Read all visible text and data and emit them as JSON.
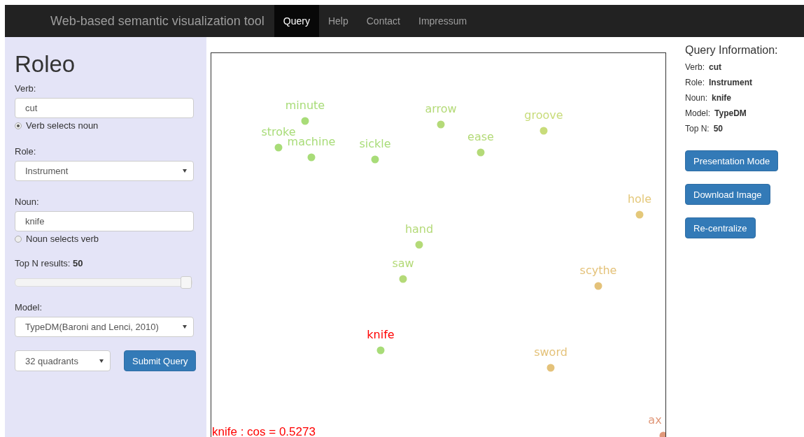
{
  "navbar": {
    "brand": "Web-based semantic visualization tool",
    "links": [
      {
        "label": "Query",
        "selected": true
      },
      {
        "label": "Help",
        "selected": false
      },
      {
        "label": "Contact",
        "selected": false
      },
      {
        "label": "Impressum",
        "selected": false
      }
    ]
  },
  "sidebar": {
    "title": "Roleo",
    "verb": {
      "label": "Verb:",
      "value": "cut",
      "radio": {
        "label": "Verb selects noun",
        "selected": true
      }
    },
    "role": {
      "label": "Role:",
      "value": "Instrument"
    },
    "noun": {
      "label": "Noun:",
      "value": "knife",
      "radio": {
        "label": "Noun selects verb",
        "selected": false
      }
    },
    "top_n": {
      "label": "Top N results:",
      "value": "50",
      "level": 1
    },
    "model": {
      "label": "Model:",
      "value": "TypeDM(Baroni and Lenci, 2010)"
    },
    "quadrants": {
      "value": "32 quadrants"
    },
    "submit": "Submit Query"
  },
  "map": {
    "words": [
      {
        "label": "minute",
        "color": "#a8dc78",
        "selected": false
      },
      {
        "label": "stroke",
        "color": "#a8dc78",
        "selected": false
      },
      {
        "label": "machine",
        "color": "#a8dc78",
        "selected": false
      },
      {
        "label": "sickle",
        "color": "#a8dc78",
        "selected": false
      },
      {
        "label": "arrow",
        "color": "#b4da78",
        "selected": false
      },
      {
        "label": "ease",
        "color": "#b4da78",
        "selected": false
      },
      {
        "label": "groove",
        "color": "#c8dc7a",
        "selected": false
      },
      {
        "label": "hole",
        "color": "#e4c87a",
        "selected": false
      },
      {
        "label": "hand",
        "color": "#b4da78",
        "selected": false
      },
      {
        "label": "saw",
        "color": "#b4da78",
        "selected": false
      },
      {
        "label": "scythe",
        "color": "#e4c27a",
        "selected": false
      },
      {
        "label": "knife",
        "color": "#a8dc78",
        "selected": true
      },
      {
        "label": "sword",
        "color": "#e4c27a",
        "selected": false
      },
      {
        "label": "ax",
        "color": "#e0987a",
        "selected": false
      }
    ],
    "footer": "knife : cos = 0.5273"
  },
  "info": {
    "title": "Query Information:",
    "rows": [
      {
        "label": "Verb:",
        "value": "cut"
      },
      {
        "label": "Role:",
        "value": "Instrument"
      },
      {
        "label": "Noun:",
        "value": "knife"
      },
      {
        "label": "Model:",
        "value": "TypeDM"
      },
      {
        "label": "Top N:",
        "value": "50"
      }
    ],
    "buttons": [
      "Presentation Mode",
      "Download Image",
      "Re-centralize"
    ]
  }
}
